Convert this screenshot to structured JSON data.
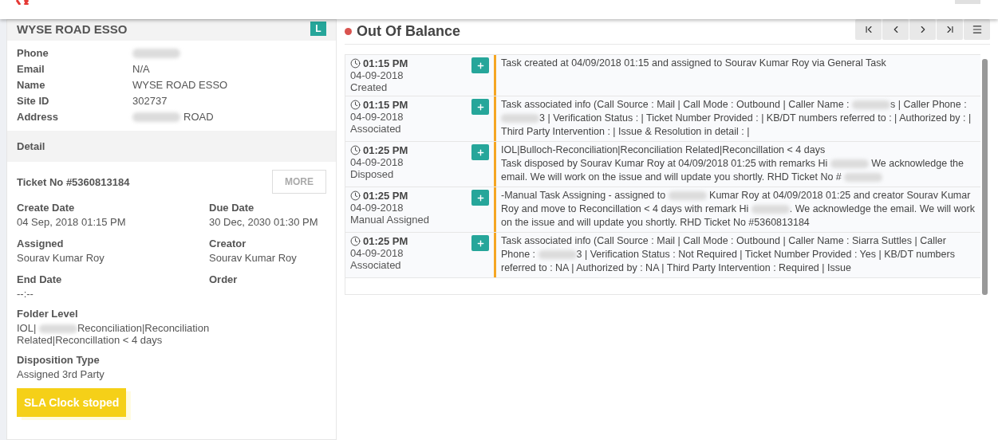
{
  "site": {
    "title": "WYSE ROAD ESSO",
    "badge": "L",
    "fields": [
      {
        "label": "Phone",
        "parts": [
          {
            "kind": "blur"
          }
        ]
      },
      {
        "label": "Email",
        "parts": [
          {
            "kind": "text",
            "text": "N/A"
          }
        ]
      },
      {
        "label": "Name",
        "parts": [
          {
            "kind": "text",
            "text": "WYSE ROAD ESSO"
          }
        ]
      },
      {
        "label": "Site ID",
        "parts": [
          {
            "kind": "text",
            "text": "302737"
          }
        ]
      },
      {
        "label": "Address",
        "parts": [
          {
            "kind": "blur"
          },
          {
            "kind": "text",
            "text": "ROAD"
          }
        ]
      }
    ]
  },
  "detail": {
    "heading": "Detail",
    "ticket": "Ticket No #5360813184",
    "more_button": "MORE",
    "pairs": [
      {
        "label": "Create Date",
        "value": "04 Sep, 2018 01:15 PM"
      },
      {
        "label": "Due Date",
        "value": "30 Dec, 2030 01:30 PM"
      },
      {
        "label": "Assigned",
        "value": "Sourav Kumar Roy"
      },
      {
        "label": "Creator",
        "value": "Sourav Kumar Roy"
      },
      {
        "label": "End Date",
        "value": "--:--"
      },
      {
        "label": "Order"
      }
    ],
    "folder": {
      "label": "Folder Level",
      "parts": [
        {
          "kind": "text",
          "text": "IOL|"
        },
        {
          "kind": "blur"
        },
        {
          "kind": "text",
          "text": "Reconciliation|Reconciliation Related|Reconcillation < 4 days"
        }
      ]
    },
    "disposition": {
      "label": "Disposition Type",
      "value": "Assigned 3rd Party"
    },
    "sla": "SLA Clock stoped"
  },
  "timeline": {
    "title": "Out Of Balance",
    "rows": [
      {
        "time": "01:15 PM",
        "date": "04-09-2018",
        "status": "Created",
        "paragraphs": [
          {
            "parts": [
              {
                "kind": "text",
                "text": "Task created at 04/09/2018 01:15 and assigned to Sourav Kumar Roy via General Task"
              }
            ]
          }
        ]
      },
      {
        "time": "01:15 PM",
        "date": "04-09-2018",
        "status": "Associated",
        "paragraphs": [
          {
            "parts": [
              {
                "kind": "text",
                "text": "Task associated info (Call Source : Mail | Call Mode : Outbound | Caller Name : "
              },
              {
                "kind": "blur"
              },
              {
                "kind": "text",
                "text": "s | Caller Phone : "
              },
              {
                "kind": "blur"
              },
              {
                "kind": "text",
                "text": "3 | Verification Status : | Ticket Number Provided : | KB/DT numbers referred to : | Authorized by : | Third Party Intervention : | Issue & Resolution in detail  : |"
              }
            ]
          }
        ]
      },
      {
        "time": "01:25 PM",
        "date": "04-09-2018",
        "status": "Disposed",
        "paragraphs": [
          {
            "parts": [
              {
                "kind": "text",
                "text": "IOL|Bulloch-Reconciliation|Reconciliation Related|Reconcillation < 4 days"
              }
            ]
          },
          {
            "parts": [
              {
                "kind": "text",
                "text": "Task disposed by Sourav Kumar Roy at 04/09/2018 01:25 with remarks Hi "
              },
              {
                "kind": "blur"
              },
              {
                "kind": "text",
                "text": " We acknowledge the email. We will work on the issue and will update you shortly. RHD Ticket No #"
              },
              {
                "kind": "blur"
              }
            ]
          }
        ]
      },
      {
        "time": "01:25 PM",
        "date": "04-09-2018",
        "status": "Manual Assigned",
        "paragraphs": [
          {
            "parts": [
              {
                "kind": "text",
                "text": "-Manual Task Assigning - assigned to "
              },
              {
                "kind": "blur"
              },
              {
                "kind": "text",
                "text": " Kumar Roy at 04/09/2018 01:25 and creator Sourav Kumar Roy and move to Reconcillation < 4 days with remark Hi "
              },
              {
                "kind": "blur"
              },
              {
                "kind": "text",
                "text": ". We acknowledge the email. We will work on the issue and will update you shortly. RHD Ticket No #5360813184"
              }
            ]
          }
        ]
      },
      {
        "time": "01:25 PM",
        "date": "04-09-2018",
        "status": "Associated",
        "paragraphs": [
          {
            "parts": [
              {
                "kind": "text",
                "text": "Task associated info (Call Source : Mail | Call Mode : Outbound | Caller Name : Siarra Suttles | Caller Phone : "
              },
              {
                "kind": "blur"
              },
              {
                "kind": "text",
                "text": "3 | Verification Status : Not Required | Ticket Number Provided : Yes | KB/DT numbers referred to : NA | Authorized by : NA | Third Party Intervention : Required | Issue"
              }
            ]
          }
        ]
      }
    ]
  }
}
